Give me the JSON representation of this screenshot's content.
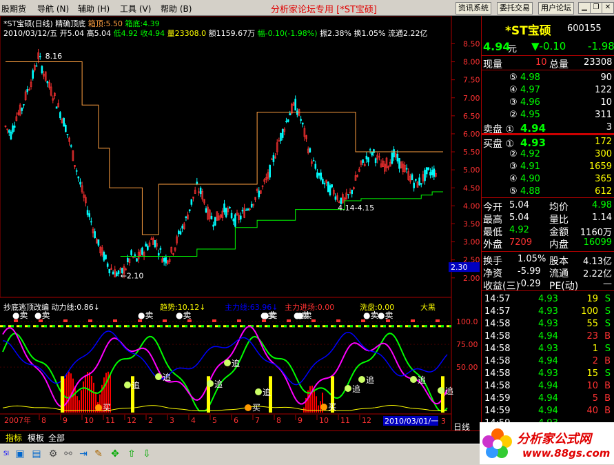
{
  "menu": {
    "items": [
      "股期货",
      "导航 (N)",
      "辅助 (H)",
      "工具 (V)",
      "帮助 (B)"
    ],
    "title": "分析家论坛专用 [*ST宝硕]",
    "right_buttons": [
      "资讯系统",
      "委托交易",
      "用户论坛"
    ]
  },
  "chart_header": {
    "line1_name": "*ST宝硕(日线) 精确顶底",
    "line1_top_label": "箱顶:5.50",
    "line1_bot_label": "箱底:4.39",
    "line2_date": "2010/03/12/五 开5.04 高5.04",
    "line2_low": "低4.92",
    "line2_close": "收4.94",
    "line2_vol": "量23308.0",
    "line2_amt": "额1159.67万",
    "line2_chg": "幅-0.10(-1.98%)",
    "line2_rest": "振2.38% 换1.05% 流通2.22亿"
  },
  "price_axis": [
    "8.50",
    "8.00",
    "7.50",
    "7.00",
    "6.50",
    "6.00",
    "5.50",
    "5.00",
    "4.50",
    "4.00",
    "3.50",
    "3.00",
    "2.50",
    "2.00"
  ],
  "price_marker": "2.30",
  "annotations": {
    "high": "8.16",
    "low": "←2.10",
    "mid": "4.14-4.15"
  },
  "indicator_header": {
    "name": "抄底逃顶改编",
    "dyn": "动力线:0.86↓",
    "trend": "趋势:10.12↓",
    "main": "主力线:63.96↓",
    "enter": "主力进场:0.00",
    "wash": "洗盘:0.00",
    "big": "大黑"
  },
  "indicator_axis": [
    "100.0",
    "75.00",
    "50.00"
  ],
  "sell_labels": [
    "●卖",
    "●卖",
    "●卖",
    "●卖",
    "●卖",
    "●卖",
    "●卖",
    "●卖",
    "●卖",
    "●卖"
  ],
  "chase_labels": [
    "追",
    "追",
    "追",
    "追",
    "追",
    "追",
    "追",
    "追",
    "追"
  ],
  "buy_labels": [
    "买",
    "买",
    "买"
  ],
  "date_axis": {
    "left": "2007年",
    "ticks": [
      "8",
      "9",
      "10",
      "11",
      "12",
      "2",
      "3",
      "4",
      "5",
      "6",
      "7",
      "8",
      "9",
      "10",
      "11",
      "12"
    ],
    "current": "2010/03/01/一",
    "last": "3"
  },
  "timeframe": "日线",
  "tabs": [
    "指标",
    "模板",
    "全部"
  ],
  "stock": {
    "name": "*ST宝硕",
    "code": "600155",
    "price": "4.94",
    "unit": "元",
    "chg": "▼-0.10",
    "pct": "-1.98"
  },
  "quote_now": {
    "label1": "现量",
    "val1": "10",
    "label2": "总量",
    "val2": "23308"
  },
  "sell_book": [
    {
      "n": "⑤",
      "p": "4.98",
      "v": "90"
    },
    {
      "n": "④",
      "p": "4.97",
      "v": "122"
    },
    {
      "n": "③",
      "p": "4.96",
      "v": "10"
    },
    {
      "n": "②",
      "p": "4.95",
      "v": "311"
    },
    {
      "n": "卖盘 ①",
      "p": "4.94",
      "v": "3"
    }
  ],
  "buy_book": [
    {
      "n": "买盘 ①",
      "p": "4.93",
      "v": "172"
    },
    {
      "n": "②",
      "p": "4.92",
      "v": "300"
    },
    {
      "n": "③",
      "p": "4.91",
      "v": "1659"
    },
    {
      "n": "④",
      "p": "4.90",
      "v": "365"
    },
    {
      "n": "⑤",
      "p": "4.88",
      "v": "612"
    }
  ],
  "stats": [
    {
      "l1": "今开",
      "v1": "5.04",
      "l2": "均价",
      "v2": "4.98"
    },
    {
      "l1": "最高",
      "v1": "5.04",
      "l2": "量比",
      "v2": "1.14"
    },
    {
      "l1": "最低",
      "v1": "4.92",
      "l2": "金额",
      "v2": "1160万"
    },
    {
      "l1": "外盘",
      "v1": "7209",
      "l2": "内盘",
      "v2": "16099"
    }
  ],
  "fund": [
    {
      "l1": "换手",
      "v1": "1.05%",
      "l2": "股本",
      "v2": "4.13亿"
    },
    {
      "l1": "净资",
      "v1": "-5.99",
      "l2": "流通",
      "v2": "2.22亿"
    },
    {
      "l1": "收益(三)",
      "v1": "-0.29",
      "l2": "PE(动)",
      "v2": "—"
    }
  ],
  "ticks": [
    {
      "t": "14:57",
      "p": "4.93",
      "v": "19",
      "s": "S"
    },
    {
      "t": "14:57",
      "p": "4.93",
      "v": "100",
      "s": "S"
    },
    {
      "t": "14:58",
      "p": "4.93",
      "v": "55",
      "s": "S"
    },
    {
      "t": "14:58",
      "p": "4.94",
      "v": "23",
      "s": "B"
    },
    {
      "t": "14:58",
      "p": "4.93",
      "v": "1",
      "s": "S"
    },
    {
      "t": "14:58",
      "p": "4.94",
      "v": "2",
      "s": "B"
    },
    {
      "t": "14:58",
      "p": "4.93",
      "v": "15",
      "s": "S"
    },
    {
      "t": "14:58",
      "p": "4.94",
      "v": "10",
      "s": "B"
    },
    {
      "t": "14:59",
      "p": "4.94",
      "v": "5",
      "s": "B"
    },
    {
      "t": "14:59",
      "p": "4.94",
      "v": "40",
      "s": "B"
    },
    {
      "t": "14:59",
      "p": "4.93",
      "v": "",
      "s": ""
    }
  ],
  "logo": {
    "cn": "分析家公式网",
    "url": "www.88gs.com"
  },
  "colors": {
    "up": "#ff3232",
    "down": "#00ffff",
    "green": "#00ff00",
    "yellow": "#ffff00",
    "orange": "#ffa040",
    "blue": "#0000ff",
    "magenta": "#ff00ff"
  },
  "chart_data": {
    "type": "line",
    "series": [
      {
        "name": "箱顶",
        "values": []
      },
      {
        "name": "箱底",
        "values": []
      }
    ],
    "ylim": [
      1.9,
      8.7
    ],
    "price_path": [
      6.2,
      6.0,
      6.5,
      6.7,
      7.2,
      7.6,
      8.16,
      7.7,
      7.3,
      7.0,
      6.6,
      6.2,
      5.6,
      5.0,
      4.4,
      3.9,
      3.4,
      2.9,
      2.6,
      2.3,
      2.15,
      2.1,
      2.3,
      2.6,
      2.5,
      2.7,
      2.9,
      3.1,
      2.8,
      2.5,
      2.6,
      2.9,
      3.3,
      3.6,
      4.1,
      4.5,
      4.3,
      3.8,
      3.6,
      3.7,
      3.9,
      3.8,
      3.6,
      3.7,
      3.9,
      4.1,
      4.3,
      4.5,
      4.8,
      5.3,
      5.8,
      6.2,
      6.6,
      6.8,
      6.4,
      5.8,
      5.3,
      4.9,
      4.7,
      4.5,
      4.4,
      4.2,
      4.14,
      4.3,
      4.7,
      5.1,
      5.3,
      5.5,
      5.3,
      5.1,
      5.2,
      5.4,
      5.2,
      5.0,
      4.8,
      4.6,
      4.7,
      4.9,
      4.95,
      4.94
    ],
    "box_top": [
      8.0,
      8.0,
      8.0,
      8.0,
      8.0,
      8.0,
      8.0,
      8.0,
      8.0,
      8.0,
      8.0,
      8.0,
      8.0,
      8.0,
      6.8,
      6.8,
      6.8,
      5.6,
      5.6,
      4.5,
      4.5,
      4.5,
      4.5,
      4.5,
      4.5,
      3.2,
      3.2,
      3.2,
      4.6,
      4.6,
      4.6,
      4.6,
      4.6,
      4.6,
      4.6,
      4.6,
      4.6,
      4.6,
      4.6,
      4.6,
      4.6,
      4.6,
      4.6,
      4.6,
      4.6,
      4.6,
      6.6,
      6.6,
      6.6,
      6.6,
      6.6,
      6.6,
      6.6,
      6.6,
      6.6,
      6.6,
      6.6,
      6.6,
      6.6,
      6.6,
      6.6,
      6.6,
      6.6,
      6.6,
      5.5,
      5.5,
      5.5,
      5.5,
      5.5,
      5.5,
      5.5,
      5.5,
      5.5,
      5.5,
      5.5,
      5.5,
      5.5,
      5.5,
      5.5,
      5.5
    ],
    "box_bottom": [
      null,
      null,
      null,
      null,
      null,
      null,
      null,
      null,
      null,
      null,
      null,
      null,
      null,
      null,
      null,
      null,
      null,
      null,
      null,
      null,
      null,
      2.6,
      2.6,
      2.6,
      2.6,
      2.6,
      2.6,
      2.6,
      2.6,
      2.6,
      2.6,
      2.6,
      2.6,
      2.6,
      2.6,
      2.8,
      2.8,
      2.8,
      2.8,
      2.8,
      2.8,
      2.8,
      3.4,
      3.4,
      3.4,
      3.4,
      3.6,
      3.6,
      3.6,
      3.6,
      3.6,
      3.6,
      3.6,
      3.9,
      3.9,
      3.9,
      3.9,
      3.9,
      3.9,
      3.9,
      3.9,
      3.9,
      4.14,
      4.14,
      4.14,
      4.2,
      4.2,
      4.2,
      4.2,
      4.2,
      4.2,
      4.2,
      4.2,
      4.2,
      4.2,
      4.2,
      4.3,
      4.3,
      4.39,
      4.39
    ]
  }
}
